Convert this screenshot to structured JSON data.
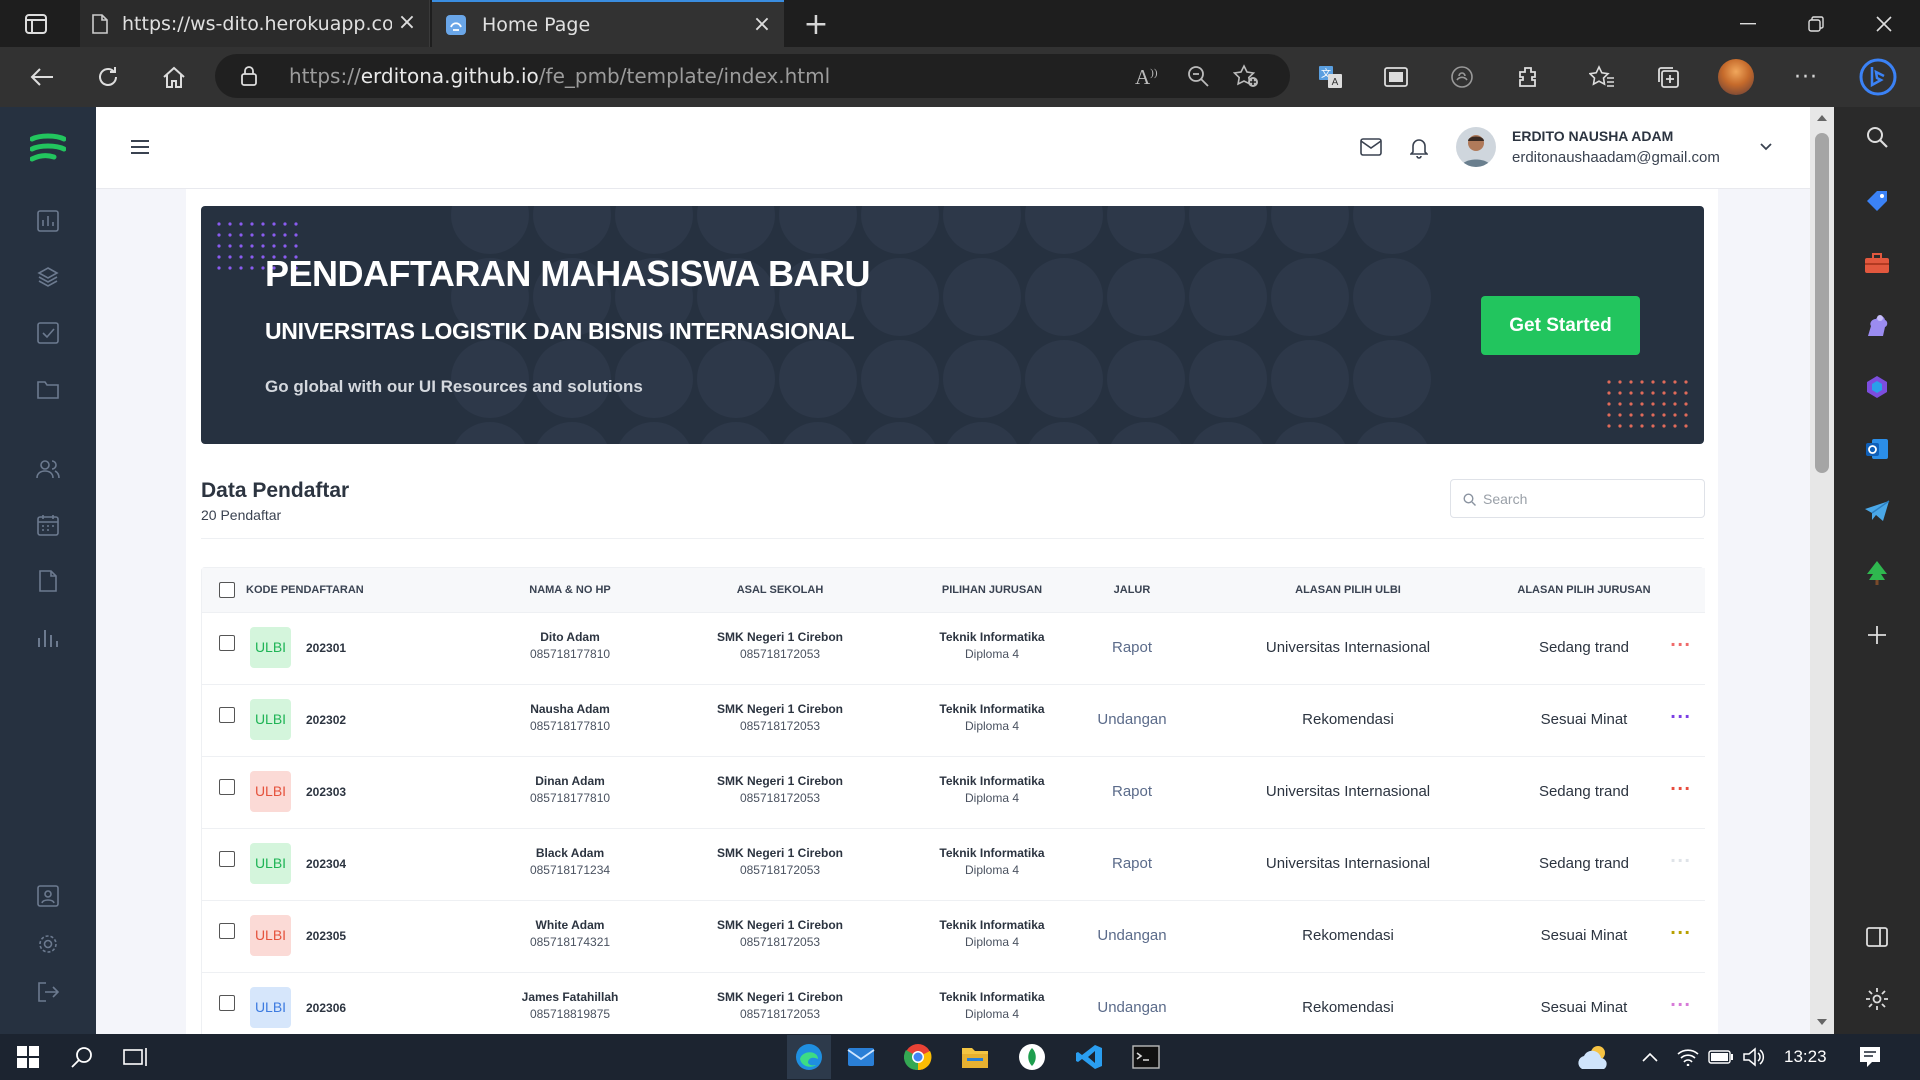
{
  "browser": {
    "tabs": [
      {
        "title": "https://ws-dito.herokuapp.com/p",
        "active": false
      },
      {
        "title": "Home Page",
        "active": true
      }
    ],
    "url_prefix": "https://",
    "url_domain": "erditona.github.io",
    "url_path": "/fe_pmb/template/index.html"
  },
  "header": {
    "user_name": "ERDITO NAUSHA ADAM",
    "user_email": "erditonaushaadam@gmail.com"
  },
  "hero": {
    "title": "PENDAFTARAN MAHASISWA BARU",
    "subtitle": "UNIVERSITAS LOGISTIK DAN BISNIS INTERNASIONAL",
    "tagline": "Go global with our UI Resources and solutions",
    "button_label": "Get Started"
  },
  "data_section": {
    "title": "Data Pendaftar",
    "count": "20 Pendaftar",
    "search_placeholder": "Search"
  },
  "table": {
    "columns": [
      "KODE PENDAFTARAN",
      "NAMA & NO HP",
      "ASAL SEKOLAH",
      "PILIHAN JURUSAN",
      "JALUR",
      "ALASAN PILIH ULBI",
      "ALASAN PILIH JURUSAN"
    ],
    "rows": [
      {
        "badge": "ULBI",
        "badge_variant": "green",
        "kode": "202301",
        "nama": "Dito Adam",
        "hp": "085718177810",
        "sekolah": "SMK Negeri 1 Cirebon",
        "sekolah_hp": "085718172053",
        "jurusan": "Teknik Informatika",
        "program": "Diploma 4",
        "jalur": "Rapot",
        "alasan_ulbi": "Universitas Internasional",
        "alasan_jurusan": "Sedang trand",
        "dots_color": "#ef6a6a"
      },
      {
        "badge": "ULBI",
        "badge_variant": "green",
        "kode": "202302",
        "nama": "Nausha Adam",
        "hp": "085718177810",
        "sekolah": "SMK Negeri 1 Cirebon",
        "sekolah_hp": "085718172053",
        "jurusan": "Teknik Informatika",
        "program": "Diploma 4",
        "jalur": "Undangan",
        "alasan_ulbi": "Rekomendasi",
        "alasan_jurusan": "Sesuai Minat",
        "dots_color": "#7b3fe4"
      },
      {
        "badge": "ULBI",
        "badge_variant": "red",
        "kode": "202303",
        "nama": "Dinan Adam",
        "hp": "085718177810",
        "sekolah": "SMK Negeri 1 Cirebon",
        "sekolah_hp": "085718172053",
        "jurusan": "Teknik Informatika",
        "program": "Diploma 4",
        "jalur": "Rapot",
        "alasan_ulbi": "Universitas Internasional",
        "alasan_jurusan": "Sedang trand",
        "dots_color": "#e84c3d"
      },
      {
        "badge": "ULBI",
        "badge_variant": "green",
        "kode": "202304",
        "nama": "Black Adam",
        "hp": "085718171234",
        "sekolah": "SMK Negeri 1 Cirebon",
        "sekolah_hp": "085718172053",
        "jurusan": "Teknik Informatika",
        "program": "Diploma 4",
        "jalur": "Rapot",
        "alasan_ulbi": "Universitas Internasional",
        "alasan_jurusan": "Sedang trand",
        "dots_color": "#dfe3e8"
      },
      {
        "badge": "ULBI",
        "badge_variant": "red",
        "kode": "202305",
        "nama": "White Adam",
        "hp": "085718174321",
        "sekolah": "SMK Negeri 1 Cirebon",
        "sekolah_hp": "085718172053",
        "jurusan": "Teknik Informatika",
        "program": "Diploma 4",
        "jalur": "Undangan",
        "alasan_ulbi": "Rekomendasi",
        "alasan_jurusan": "Sesuai Minat",
        "dots_color": "#b8a000"
      },
      {
        "badge": "ULBI",
        "badge_variant": "blue",
        "kode": "202306",
        "nama": "James Fatahillah",
        "hp": "085718819875",
        "sekolah": "SMK Negeri 1 Cirebon",
        "sekolah_hp": "085718172053",
        "jurusan": "Teknik Informatika",
        "program": "Diploma 4",
        "jalur": "Undangan",
        "alasan_ulbi": "Rekomendasi",
        "alasan_jurusan": "Sesuai Minat",
        "dots_color": "#d77ad8"
      }
    ]
  },
  "badge_colors": {
    "green": {
      "bg": "#d4f5dc",
      "fg": "#1fb456"
    },
    "red": {
      "bg": "#fbdad6",
      "fg": "#e5533d"
    },
    "blue": {
      "bg": "#d6e6fb",
      "fg": "#3d7be0"
    }
  },
  "colors": {
    "accent": "#22c55e",
    "sidebar": "#263140",
    "jalur_text": "#5b6b8a"
  },
  "taskbar": {
    "time": "13:23"
  }
}
